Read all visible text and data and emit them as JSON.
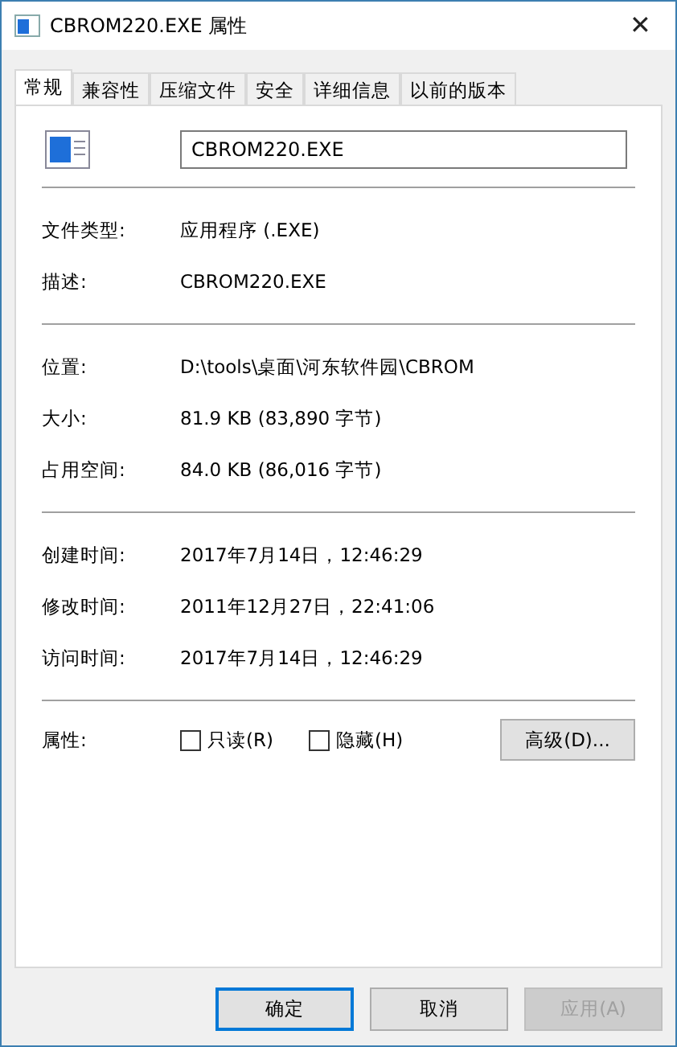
{
  "window": {
    "title": "CBROM220.EXE 属性",
    "close": "✕"
  },
  "tabs": [
    {
      "label": "常规",
      "selected": true
    },
    {
      "label": "兼容性",
      "selected": false
    },
    {
      "label": "压缩文件",
      "selected": false
    },
    {
      "label": "安全",
      "selected": false
    },
    {
      "label": "详细信息",
      "selected": false
    },
    {
      "label": "以前的版本",
      "selected": false
    }
  ],
  "file_name": "CBROM220.EXE",
  "groups": [
    [
      {
        "label": "文件类型:",
        "value": "应用程序 (.EXE)"
      },
      {
        "label": "描述:",
        "value": "CBROM220.EXE"
      }
    ],
    [
      {
        "label": "位置:",
        "value": "D:\\tools\\桌面\\河东软件园\\CBROM"
      },
      {
        "label": "大小:",
        "value": "81.9 KB (83,890 字节)"
      },
      {
        "label": "占用空间:",
        "value": "84.0 KB (86,016 字节)"
      }
    ],
    [
      {
        "label": "创建时间:",
        "value": "2017年7月14日，12:46:29"
      },
      {
        "label": "修改时间:",
        "value": "2011年12月27日，22:41:06"
      },
      {
        "label": "访问时间:",
        "value": "2017年7月14日，12:46:29"
      }
    ]
  ],
  "attributes": {
    "label": "属性:",
    "checkboxes": [
      {
        "label": "只读(R)",
        "checked": false
      },
      {
        "label": "隐藏(H)",
        "checked": false
      }
    ],
    "advanced_button": "高级(D)..."
  },
  "buttons": [
    {
      "label": "确定",
      "default": true,
      "disabled": false
    },
    {
      "label": "取消",
      "default": false,
      "disabled": false
    },
    {
      "label": "应用(A)",
      "default": false,
      "disabled": true
    }
  ]
}
